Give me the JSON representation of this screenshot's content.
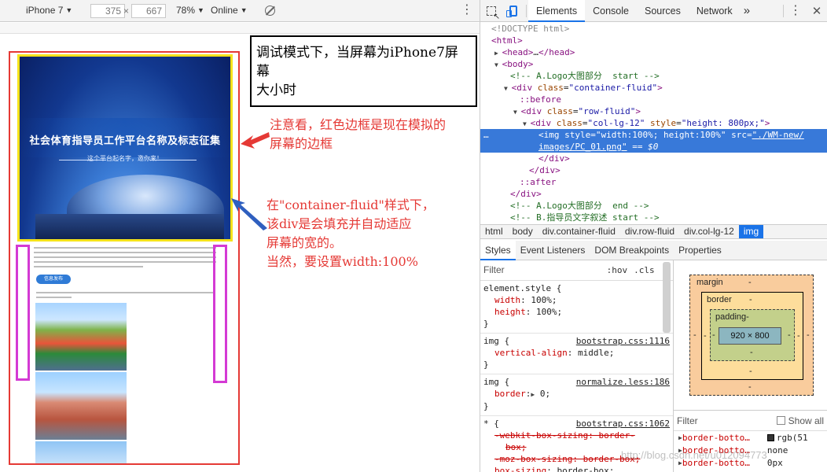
{
  "device_toolbar": {
    "device_name": "iPhone 7",
    "width": "375",
    "height": "667",
    "times": "×",
    "zoom": "78%",
    "network": "Online"
  },
  "phone": {
    "hero_title": "社会体育指导员工作平台名称及标志征集",
    "hero_sub": "这个平台起名字，邀你来！",
    "join_button": "信息发布"
  },
  "annotations": {
    "box_line1": "调试模式下，当屏幕为iPhone7屏幕",
    "box_line2": "大小时",
    "red1_line1": "注意看，红色边框是现在模拟的",
    "red1_line2": "屏幕的边框",
    "red2_line1": "在\"container-fluid\"样式下，",
    "red2_line2": "该div是会填充并自动适应",
    "red2_line3": "屏幕的宽的。",
    "red2_line4": "当然，要设置width:100%"
  },
  "devtools": {
    "tabs": [
      "Elements",
      "Console",
      "Sources",
      "Network"
    ],
    "more": "»",
    "dom": {
      "doctype": "<!DOCTYPE html>",
      "html_open": "html",
      "head": "head",
      "head_ellipsis": "…",
      "body_open": "body",
      "comment1": "<!-- A.Logo大图部分  start -->",
      "div1_tag": "div",
      "div1_attr": "class",
      "div1_val": "\"container-fluid\"",
      "before": "::before",
      "div2_tag": "div",
      "div2_attr": "class",
      "div2_val": "\"row-fluid\"",
      "div3_tag": "div",
      "div3_attr1": "class",
      "div3_val1": "\"col-lg-12\"",
      "div3_attr2": "style",
      "div3_val2": "\"height: 800px;\"",
      "img_tag": "img",
      "img_attr1": "style",
      "img_val1": "\"width:100%; height:100%\"",
      "img_attr2": "src",
      "img_src_part1": "\"./WM-new/",
      "img_src_part2": "images/PC_01.png\"",
      "img_eq": "== $0",
      "div_close": "div",
      "after": "::after",
      "comment2": "<!-- A.Logo大图部分  end -->",
      "comment3": "<!-- B.指导员文字叙述 start -->"
    },
    "breadcrumbs": [
      "html",
      "body",
      "div.container-fluid",
      "div.row-fluid",
      "div.col-lg-12",
      "img"
    ],
    "subtabs": [
      "Styles",
      "Event Listeners",
      "DOM Breakpoints",
      "Properties"
    ],
    "filter": "Filter",
    "hov": ":hov",
    "cls": ".cls",
    "rules": {
      "r1_selector": "element.style {",
      "r1_p1_name": "width",
      "r1_p1_val": "100%;",
      "r1_p2_name": "height",
      "r1_p2_val": "100%;",
      "close": "}",
      "r2_selector": "img {",
      "r2_source": "bootstrap.css:1116",
      "r2_p1_name": "vertical-align",
      "r2_p1_val": "middle;",
      "r3_selector": "img {",
      "r3_source": "normalize.less:186",
      "r3_p1_name": "border",
      "r3_p1_val": "0;",
      "r4_selector": "* {",
      "r4_source": "bootstrap.css:1062",
      "r4_p1": "-webkit-box-sizing: border-",
      "r4_p1b": "box;",
      "r4_p2": "-moz-box-sizing: border-box;",
      "r4_p3_name": "box-sizing",
      "r4_p3_val": "border-box;"
    },
    "boxmodel": {
      "margin": "margin",
      "border": "border",
      "padding": "padding-",
      "content": "920 × 800",
      "dash": "-"
    },
    "computed": {
      "filter": "Filter",
      "show_all": "Show all",
      "rows": [
        {
          "name": "border-botto…",
          "value": "rgb(51"
        },
        {
          "name": "border-botto…",
          "value": "none"
        },
        {
          "name": "border-botto…",
          "value": "0px"
        }
      ]
    },
    "watermark": "http://blog.csdn.net/u012094773"
  }
}
